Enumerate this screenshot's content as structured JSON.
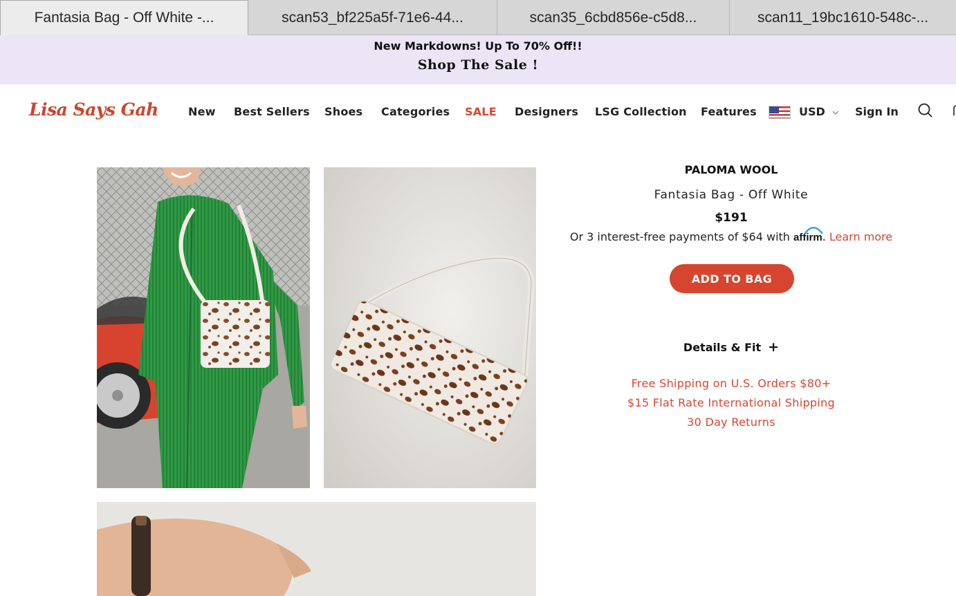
{
  "browser": {
    "tabs": [
      {
        "title": "Fantasia Bag - Off White -..."
      },
      {
        "title": "scan53_bf225a5f-71e6-44..."
      },
      {
        "title": "scan35_6cbd856e-c5d8..."
      },
      {
        "title": "scan11_19bc1610-548c-..."
      }
    ]
  },
  "announcement": {
    "line1": "New Markdowns! Up To 70% Off!!",
    "line2": "Shop The Sale !"
  },
  "header": {
    "logo": "Lisa Says Gah",
    "nav": [
      "New",
      "Best Sellers",
      "Shoes",
      "Categories",
      "SALE",
      "Designers",
      "LSG Collection",
      "Features"
    ],
    "currency": "USD",
    "sign_in": "Sign In",
    "icons": {
      "flag": "us-flag-icon",
      "chevron": "chevron-down-icon",
      "search": "search-icon",
      "cart": "cart-icon"
    }
  },
  "product": {
    "brand": "PALOMA WOOL",
    "name": "Fantasia Bag - Off White",
    "price": "$191",
    "affirm_prefix": "Or 3 interest-free payments of $64 with",
    "affirm_logo": "affirm",
    "affirm_learn": "Learn more",
    "add_to_bag": "ADD TO BAG",
    "details_label": "Details & Fit",
    "details_toggle": "+",
    "shipping": [
      "Free Shipping on U.S. Orders $80+",
      "$15 Flat Rate International Shipping",
      "30 Day Returns"
    ]
  },
  "colors": {
    "brand_red": "#d6452f",
    "announcement_bg": "#ebe5f6"
  }
}
